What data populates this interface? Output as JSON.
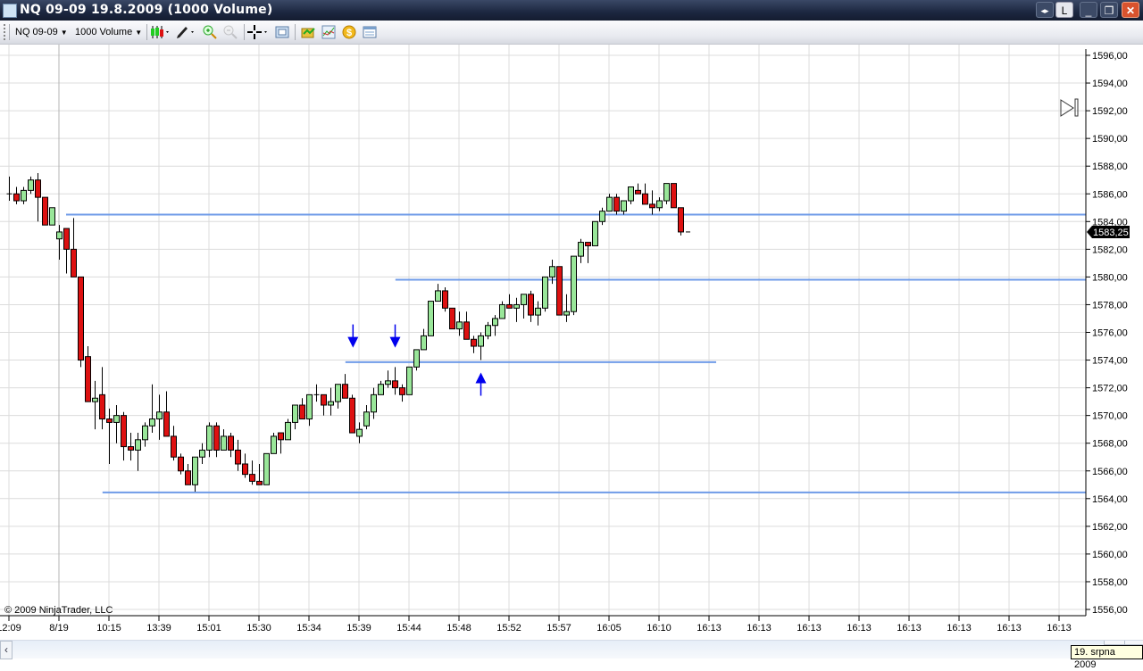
{
  "window": {
    "title": "NQ 09-09  19.8.2009 (1000 Volume)",
    "buttons": {
      "scroll_toggle": "◂▸",
      "link": "L",
      "minimize": "_",
      "restore": "❐",
      "close": "✕"
    }
  },
  "toolbar": {
    "instrument": "NQ 09-09",
    "period": "1000 Volume",
    "icons": [
      "candlestick-style-icon",
      "drawing-pencil-icon",
      "zoom-in-icon",
      "zoom-out-icon",
      "crosshair-icon",
      "properties-icon",
      "strategy-icon",
      "indicators-icon",
      "order-icon",
      "data-box-icon"
    ]
  },
  "chart": {
    "copyright": "© 2009 NinjaTrader, LLC",
    "last_price_label": "1583,25",
    "date_tooltip": "19. srpna 2009",
    "colors": {
      "up": "#99e699",
      "down": "#dd1111",
      "hline": "#6f9be8",
      "arrow": "#0000ee",
      "grid": "#dcdcdc"
    }
  },
  "chart_data": {
    "type": "candlestick",
    "title": "NQ 09-09 19.8.2009 (1000 Volume)",
    "ylim": [
      1556,
      1596
    ],
    "y_ticks": [
      "1596,00",
      "1594,00",
      "1592,00",
      "1590,00",
      "1588,00",
      "1586,00",
      "1584,00",
      "1582,00",
      "1580,00",
      "1578,00",
      "1576,00",
      "1574,00",
      "1572,00",
      "1570,00",
      "1568,00",
      "1566,00",
      "1564,00",
      "1562,00",
      "1560,00",
      "1558,00",
      "1556,00"
    ],
    "y_tick_values": [
      1596,
      1594,
      1592,
      1590,
      1588,
      1586,
      1584,
      1582,
      1580,
      1578,
      1576,
      1574,
      1572,
      1570,
      1568,
      1566,
      1564,
      1562,
      1560,
      1558,
      1556
    ],
    "x_tick_every_bars": 7,
    "x_ticks": [
      "12:09",
      "8/19",
      "10:15",
      "13:39",
      "15:01",
      "15:30",
      "15:34",
      "15:39",
      "15:44",
      "15:48",
      "15:52",
      "15:57",
      "16:05",
      "16:10",
      "16:13",
      "16:13",
      "16:13",
      "16:13",
      "16:13",
      "16:13",
      "16:13",
      "16:13"
    ],
    "candles_ohlc": [
      [
        1586.0,
        1587.25,
        1585.5,
        1586.0
      ],
      [
        1586.0,
        1586.5,
        1585.25,
        1585.5
      ],
      [
        1585.5,
        1586.5,
        1585.25,
        1586.25
      ],
      [
        1586.25,
        1587.25,
        1586.0,
        1587.0
      ],
      [
        1587.0,
        1587.5,
        1584.0,
        1585.75
      ],
      [
        1585.75,
        1585.75,
        1583.75,
        1583.75
      ],
      [
        1583.75,
        1585.0,
        1583.75,
        1585.0
      ],
      [
        1582.75,
        1583.75,
        1581.25,
        1583.25
      ],
      [
        1583.5,
        1583.5,
        1580.25,
        1582.0
      ],
      [
        1582.0,
        1584.25,
        1580.0,
        1580.0
      ],
      [
        1580.0,
        1580.0,
        1573.5,
        1574.0
      ],
      [
        1574.25,
        1575.0,
        1571.0,
        1571.0
      ],
      [
        1571.0,
        1572.5,
        1569.0,
        1571.25
      ],
      [
        1571.5,
        1573.5,
        1569.0,
        1569.75
      ],
      [
        1569.75,
        1570.5,
        1566.5,
        1569.5
      ],
      [
        1569.5,
        1570.75,
        1568.0,
        1570.0
      ],
      [
        1570.0,
        1570.25,
        1566.75,
        1567.75
      ],
      [
        1567.75,
        1568.75,
        1566.75,
        1567.5
      ],
      [
        1567.5,
        1568.75,
        1566.0,
        1568.25
      ],
      [
        1568.25,
        1569.5,
        1567.75,
        1569.25
      ],
      [
        1569.25,
        1572.25,
        1568.75,
        1569.75
      ],
      [
        1569.75,
        1571.5,
        1568.25,
        1570.25
      ],
      [
        1570.25,
        1571.75,
        1568.5,
        1568.5
      ],
      [
        1568.5,
        1569.25,
        1566.75,
        1567.0
      ],
      [
        1567.0,
        1567.25,
        1565.75,
        1566.0
      ],
      [
        1566.0,
        1566.5,
        1565.0,
        1565.0
      ],
      [
        1565.0,
        1567.0,
        1564.5,
        1567.0
      ],
      [
        1567.0,
        1568.0,
        1566.5,
        1567.5
      ],
      [
        1567.5,
        1569.5,
        1567.0,
        1569.25
      ],
      [
        1569.25,
        1569.5,
        1567.0,
        1567.5
      ],
      [
        1567.5,
        1569.0,
        1567.5,
        1568.5
      ],
      [
        1568.5,
        1568.75,
        1567.0,
        1567.5
      ],
      [
        1567.5,
        1568.25,
        1566.0,
        1566.5
      ],
      [
        1566.5,
        1567.25,
        1565.5,
        1565.75
      ],
      [
        1565.75,
        1566.75,
        1565.0,
        1565.25
      ],
      [
        1565.25,
        1566.5,
        1565.0,
        1565.0
      ],
      [
        1565.0,
        1567.25,
        1565.0,
        1567.25
      ],
      [
        1567.25,
        1568.75,
        1567.25,
        1568.5
      ],
      [
        1568.75,
        1568.75,
        1567.25,
        1568.25
      ],
      [
        1568.25,
        1569.75,
        1568.25,
        1569.5
      ],
      [
        1569.5,
        1570.75,
        1569.0,
        1570.75
      ],
      [
        1570.75,
        1571.25,
        1569.75,
        1569.75
      ],
      [
        1569.75,
        1571.5,
        1569.25,
        1571.5
      ],
      [
        1571.5,
        1572.25,
        1571.0,
        1571.5
      ],
      [
        1571.5,
        1571.5,
        1570.0,
        1570.75
      ],
      [
        1570.75,
        1572.0,
        1570.0,
        1571.0
      ],
      [
        1571.0,
        1572.25,
        1570.5,
        1572.25
      ],
      [
        1572.25,
        1573.0,
        1571.25,
        1571.25
      ],
      [
        1571.25,
        1571.5,
        1568.75,
        1568.75
      ],
      [
        1568.5,
        1569.5,
        1568.0,
        1569.0
      ],
      [
        1569.25,
        1570.75,
        1569.0,
        1570.25
      ],
      [
        1570.25,
        1572.0,
        1569.75,
        1571.5
      ],
      [
        1571.5,
        1572.5,
        1571.5,
        1572.25
      ],
      [
        1572.25,
        1573.25,
        1572.0,
        1572.5
      ],
      [
        1572.5,
        1573.5,
        1571.5,
        1572.0
      ],
      [
        1572.0,
        1572.25,
        1571.0,
        1571.5
      ],
      [
        1571.5,
        1573.5,
        1571.5,
        1573.5
      ],
      [
        1573.5,
        1574.75,
        1573.25,
        1574.75
      ],
      [
        1574.75,
        1576.25,
        1574.75,
        1575.75
      ],
      [
        1575.75,
        1578.25,
        1575.75,
        1578.25
      ],
      [
        1578.25,
        1579.5,
        1578.25,
        1579.0
      ],
      [
        1579.0,
        1579.25,
        1577.5,
        1577.75
      ],
      [
        1577.75,
        1577.75,
        1576.25,
        1576.25
      ],
      [
        1576.25,
        1577.5,
        1575.75,
        1576.75
      ],
      [
        1576.75,
        1577.5,
        1575.5,
        1575.5
      ],
      [
        1575.5,
        1575.75,
        1574.5,
        1575.0
      ],
      [
        1575.0,
        1576.0,
        1574.0,
        1575.75
      ],
      [
        1575.75,
        1576.75,
        1575.5,
        1576.5
      ],
      [
        1576.5,
        1577.25,
        1575.75,
        1577.0
      ],
      [
        1577.0,
        1578.25,
        1577.0,
        1578.0
      ],
      [
        1578.0,
        1578.75,
        1577.75,
        1577.75
      ],
      [
        1577.75,
        1578.5,
        1576.75,
        1578.0
      ],
      [
        1578.0,
        1578.75,
        1577.0,
        1578.75
      ],
      [
        1578.75,
        1579.0,
        1576.75,
        1577.25
      ],
      [
        1577.25,
        1578.25,
        1576.5,
        1577.75
      ],
      [
        1577.75,
        1580.0,
        1577.5,
        1580.0
      ],
      [
        1580.0,
        1581.25,
        1579.5,
        1580.75
      ],
      [
        1580.75,
        1580.75,
        1577.25,
        1577.25
      ],
      [
        1577.25,
        1578.75,
        1576.75,
        1577.5
      ],
      [
        1577.5,
        1581.5,
        1577.25,
        1581.5
      ],
      [
        1581.5,
        1582.75,
        1581.0,
        1582.5
      ],
      [
        1582.5,
        1582.5,
        1581.0,
        1582.25
      ],
      [
        1582.25,
        1584.0,
        1582.25,
        1584.0
      ],
      [
        1584.0,
        1585.0,
        1583.75,
        1584.75
      ],
      [
        1584.75,
        1586.0,
        1584.75,
        1585.75
      ],
      [
        1585.75,
        1586.0,
        1584.5,
        1584.75
      ],
      [
        1584.75,
        1585.5,
        1584.5,
        1585.5
      ],
      [
        1585.5,
        1586.5,
        1585.25,
        1586.5
      ],
      [
        1586.25,
        1586.75,
        1586.0,
        1586.0
      ],
      [
        1586.0,
        1586.75,
        1585.25,
        1585.25
      ],
      [
        1585.25,
        1586.25,
        1584.5,
        1585.0
      ],
      [
        1585.0,
        1585.75,
        1584.75,
        1585.5
      ],
      [
        1585.5,
        1586.75,
        1585.25,
        1586.75
      ],
      [
        1586.75,
        1586.75,
        1585.0,
        1585.0
      ],
      [
        1585.0,
        1585.0,
        1583.0,
        1583.25
      ]
    ],
    "horizontal_lines": [
      {
        "price": 1584.5,
        "start_bar": 8,
        "end_bar": null
      },
      {
        "price": 1579.8,
        "start_bar": 54.1,
        "end_bar": null
      },
      {
        "price": 1573.85,
        "start_bar": 47.1,
        "end_bar": 99
      },
      {
        "price": 1564.45,
        "start_bar": 13.1,
        "end_bar": null
      }
    ],
    "arrows": [
      {
        "direction": "down",
        "bar": 48.1,
        "price": 1574.9
      },
      {
        "direction": "down",
        "bar": 54,
        "price": 1574.9
      },
      {
        "direction": "up",
        "bar": 66,
        "price": 1573.1
      }
    ],
    "last_price": 1583.25
  }
}
